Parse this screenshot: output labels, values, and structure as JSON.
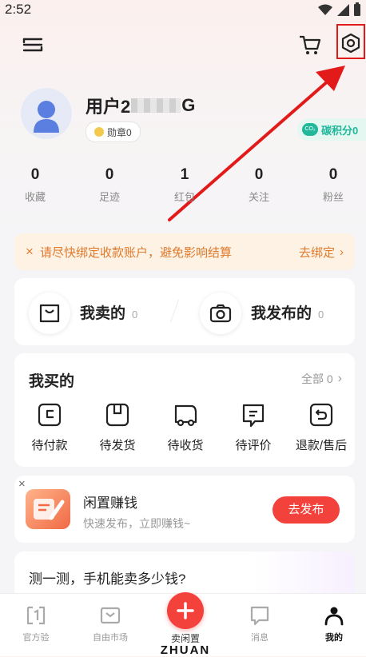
{
  "status_bar": {
    "time": "2:52"
  },
  "header": {
    "menu_icon": "menu-icon",
    "cart_icon": "cart-icon",
    "settings_icon": "settings-icon"
  },
  "profile": {
    "username": "用户2",
    "username_suffix": "G",
    "badge_label": "勋章0",
    "carbon_label": "碳积分0"
  },
  "stats": [
    {
      "value": "0",
      "label": "收藏"
    },
    {
      "value": "0",
      "label": "足迹"
    },
    {
      "value": "1",
      "label": "红包"
    },
    {
      "value": "0",
      "label": "关注"
    },
    {
      "value": "0",
      "label": "粉丝"
    }
  ],
  "notice": {
    "text": "请尽快绑定收款账户，避免影响结算",
    "action": "去绑定"
  },
  "selling": {
    "sold_label": "我卖的",
    "sold_count": "0",
    "posted_label": "我发布的",
    "posted_count": "0"
  },
  "bought": {
    "title": "我买的",
    "all_label": "全部 0",
    "items": [
      {
        "label": "待付款",
        "icon": "wallet-icon"
      },
      {
        "label": "待发货",
        "icon": "package-icon"
      },
      {
        "label": "待收货",
        "icon": "truck-icon"
      },
      {
        "label": "待评价",
        "icon": "comment-icon"
      },
      {
        "label": "退款/售后",
        "icon": "return-icon"
      }
    ]
  },
  "promo": {
    "title": "闲置赚钱",
    "subtitle": "快速发布，立即赚钱~",
    "button": "去发布",
    "close": "×"
  },
  "quiz": {
    "text": "测一测，手机能卖多少钱?"
  },
  "bottom_nav": {
    "items": [
      {
        "label": "官方验",
        "icon": "verify-icon"
      },
      {
        "label": "自由市场",
        "icon": "market-icon"
      },
      {
        "label": "卖闲置",
        "icon": "plus-icon"
      },
      {
        "label": "消息",
        "icon": "message-icon"
      },
      {
        "label": "我的",
        "icon": "profile-icon"
      }
    ],
    "brand": "ZHUAN"
  },
  "colors": {
    "accent": "#f3413b",
    "annotation": "#e21a1a",
    "notice_text": "#e07a2c",
    "carbon": "#1fb89b"
  }
}
